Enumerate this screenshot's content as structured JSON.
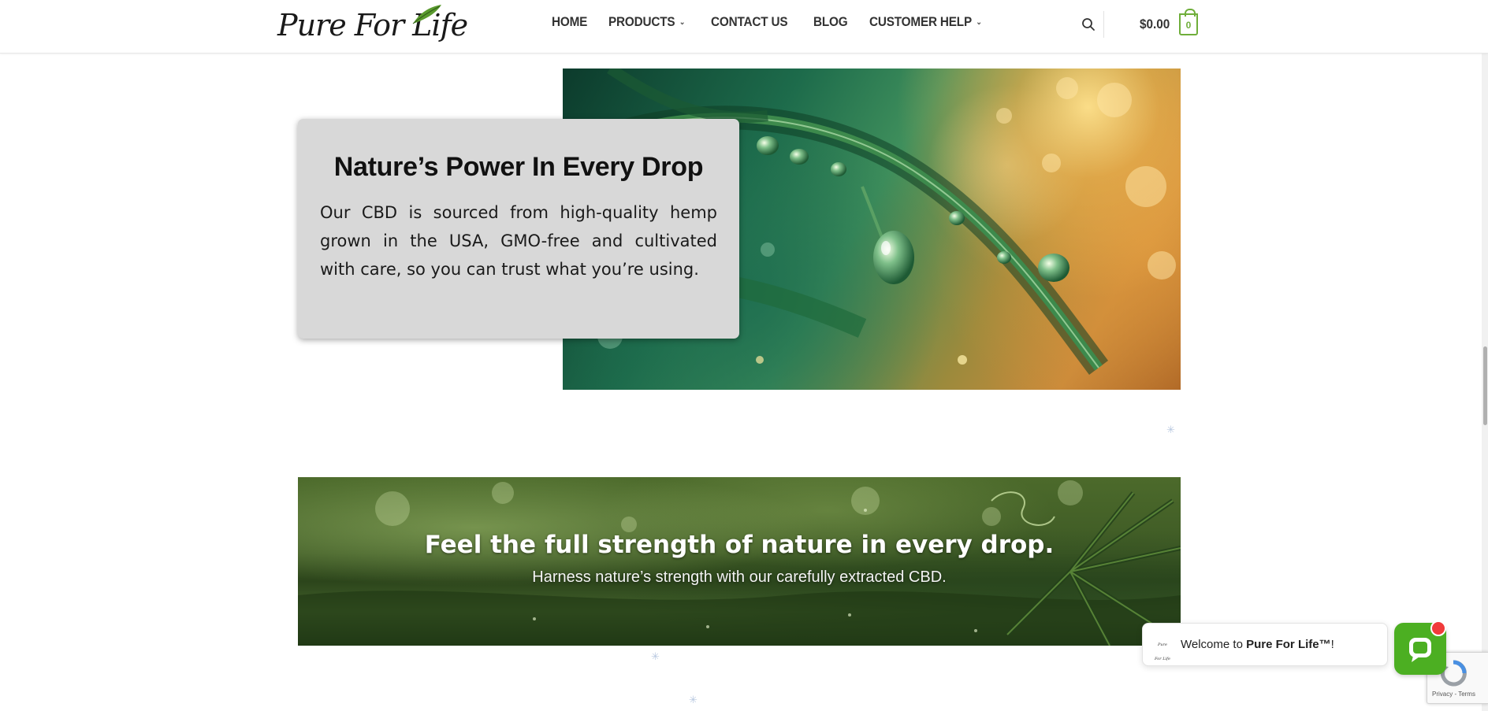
{
  "header": {
    "logo_text": "Pure For Life",
    "nav": [
      {
        "label": "HOME",
        "has_dropdown": false
      },
      {
        "label": "PRODUCTS",
        "has_dropdown": true
      },
      {
        "label": "CONTACT US",
        "has_dropdown": false
      },
      {
        "label": "BLOG",
        "has_dropdown": false
      },
      {
        "label": "CUSTOMER HELP",
        "has_dropdown": true
      }
    ],
    "cart_total": "$0.00",
    "cart_count": "0"
  },
  "feature": {
    "title": "Nature’s Power In Every Drop",
    "body": "Our CBD is sourced from high-quality hemp grown in the USA, GMO-free and cultivated with care, so you can trust what you’re using."
  },
  "banner": {
    "title": "Feel the full strength of nature in every drop.",
    "subtitle": "Harness nature’s strength with our carefully extracted CBD."
  },
  "chat": {
    "avatar_text": "Pure For Life",
    "message_prefix": "Welcome to ",
    "brand": "Pure For Life™",
    "message_suffix": "!"
  },
  "recaptcha": {
    "links": "Privacy - Terms"
  },
  "colors": {
    "accent_green": "#6fae3a",
    "chat_green": "#4caf22",
    "badge_red": "#f03a3a",
    "card_gray": "#d8d8d8"
  }
}
